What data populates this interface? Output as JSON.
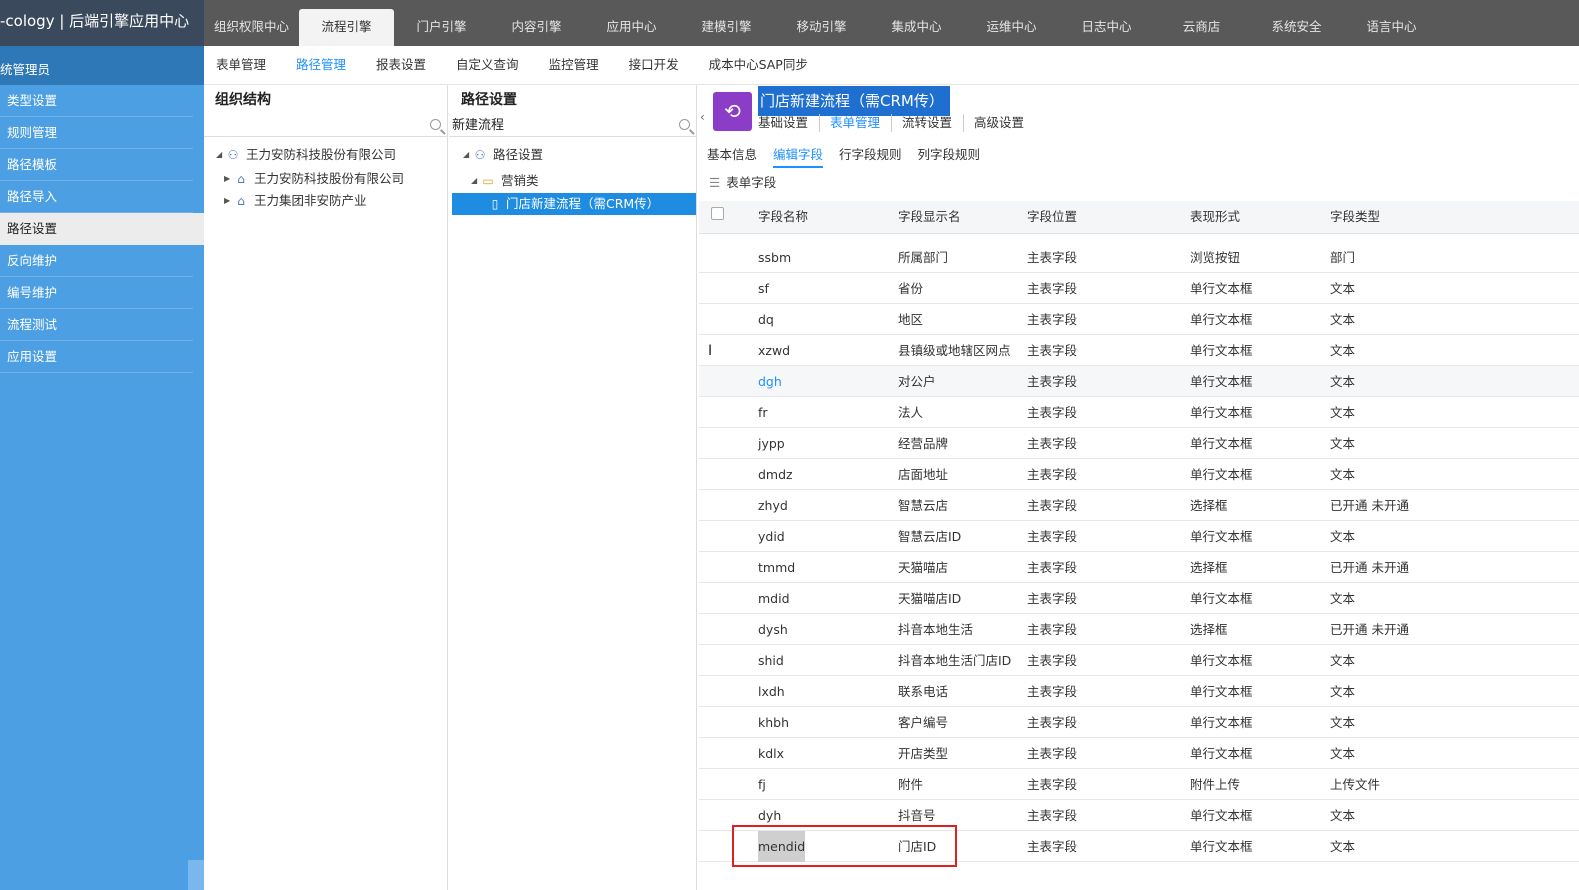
{
  "brand": "-cology | 后端引擎应用中心",
  "topnav": [
    "组织权限中心",
    "流程引擎",
    "门户引擎",
    "内容引擎",
    "应用中心",
    "建模引擎",
    "移动引擎",
    "集成中心",
    "运维中心",
    "日志中心",
    "云商店",
    "系统安全",
    "语言中心"
  ],
  "topnav_active": 1,
  "subnav": [
    "表单管理",
    "路径管理",
    "报表设置",
    "自定义查询",
    "监控管理",
    "接口开发",
    "成本中心SAP同步"
  ],
  "subnav_active": 1,
  "sidebar": {
    "header": "统管理员",
    "items": [
      "类型设置",
      "规则管理",
      "路径模板",
      "路径导入",
      "路径设置",
      "反向维护",
      "编号维护",
      "流程测试",
      "应用设置"
    ],
    "active": 4
  },
  "org": {
    "title": "组织结构",
    "search": "",
    "nodes": [
      "王力安防科技股份有限公司",
      "王力安防科技股份有限公司",
      "王力集团非安防产业"
    ]
  },
  "path": {
    "title": "路径设置",
    "search": "新建流程",
    "nodes": [
      "路径设置",
      "营销类",
      "门店新建流程（需CRM传）"
    ]
  },
  "workflow": {
    "title": "门店新建流程（需CRM传）",
    "icon": "workflow-icon",
    "tabs": [
      "基础设置",
      "表单管理",
      "流转设置",
      "高级设置"
    ],
    "active_tab": 1,
    "subtabs": [
      "基本信息",
      "编辑字段",
      "行字段规则",
      "列字段规则"
    ],
    "active_subtab": 1,
    "section": "表单字段"
  },
  "table": {
    "headers": [
      "字段名称",
      "字段显示名",
      "字段位置",
      "表现形式",
      "字段类型"
    ],
    "rows": [
      [
        "ssbm",
        "所属部门",
        "主表字段",
        "浏览按钮",
        "部门"
      ],
      [
        "sf",
        "省份",
        "主表字段",
        "单行文本框",
        "文本"
      ],
      [
        "dq",
        "地区",
        "主表字段",
        "单行文本框",
        "文本"
      ],
      [
        "xzwd",
        "县镇级或地辖区网点",
        "主表字段",
        "单行文本框",
        "文本"
      ],
      [
        "dgh",
        "对公户",
        "主表字段",
        "单行文本框",
        "文本"
      ],
      [
        "fr",
        "法人",
        "主表字段",
        "单行文本框",
        "文本"
      ],
      [
        "jypp",
        "经营品牌",
        "主表字段",
        "单行文本框",
        "文本"
      ],
      [
        "dmdz",
        "店面地址",
        "主表字段",
        "单行文本框",
        "文本"
      ],
      [
        "zhyd",
        "智慧云店",
        "主表字段",
        "选择框",
        "已开通 未开通"
      ],
      [
        "ydid",
        "智慧云店ID",
        "主表字段",
        "单行文本框",
        "文本"
      ],
      [
        "tmmd",
        "天猫喵店",
        "主表字段",
        "选择框",
        "已开通 未开通"
      ],
      [
        "mdid",
        "天猫喵店ID",
        "主表字段",
        "单行文本框",
        "文本"
      ],
      [
        "dysh",
        "抖音本地生活",
        "主表字段",
        "选择框",
        "已开通 未开通"
      ],
      [
        "shid",
        "抖音本地生活门店ID",
        "主表字段",
        "单行文本框",
        "文本"
      ],
      [
        "lxdh",
        "联系电话",
        "主表字段",
        "单行文本框",
        "文本"
      ],
      [
        "khbh",
        "客户编号",
        "主表字段",
        "单行文本框",
        "文本"
      ],
      [
        "kdlx",
        "开店类型",
        "主表字段",
        "单行文本框",
        "文本"
      ],
      [
        "fj",
        "附件",
        "主表字段",
        "附件上传",
        "上传文件"
      ],
      [
        "dyh",
        "抖音号",
        "主表字段",
        "单行文本框",
        "文本"
      ],
      [
        "mendid",
        "门店ID",
        "主表字段",
        "单行文本框",
        "文本"
      ]
    ]
  }
}
